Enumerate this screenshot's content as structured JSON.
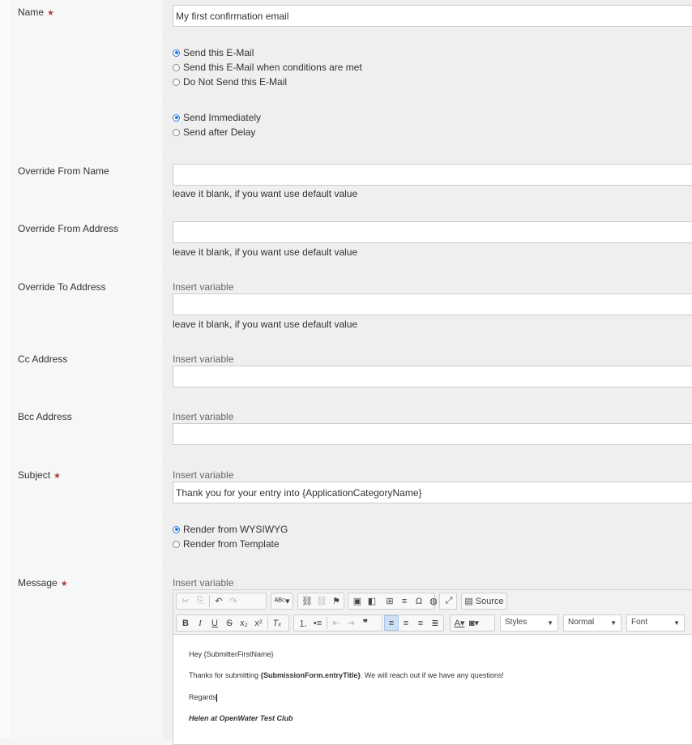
{
  "fields": {
    "name": {
      "label": "Name",
      "value": "My first confirmation email"
    },
    "send_mode": {
      "options": [
        "Send this E-Mail",
        "Send this E-Mail when conditions are met",
        "Do Not Send this E-Mail"
      ],
      "selected": "Send this E-Mail"
    },
    "timing": {
      "options": [
        "Send Immediately",
        "Send after Delay"
      ],
      "selected": "Send Immediately"
    },
    "from_name": {
      "label": "Override From Name",
      "value": "",
      "help": "leave it blank, if you want use default value"
    },
    "from_address": {
      "label": "Override From Address",
      "value": "",
      "help": "leave it blank, if you want use default value"
    },
    "to_address": {
      "label": "Override To Address",
      "insert_variable": "Insert variable",
      "value": "",
      "help": "leave it blank, if you want use default value"
    },
    "cc": {
      "label": "Cc Address",
      "insert_variable": "Insert variable",
      "value": ""
    },
    "bcc": {
      "label": "Bcc Address",
      "insert_variable": "Insert variable",
      "value": ""
    },
    "subject": {
      "label": "Subject",
      "insert_variable": "Insert variable",
      "value": "Thank you for your entry into {ApplicationCategoryName}"
    },
    "render": {
      "options": [
        "Render from WYSIWYG",
        "Render from Template"
      ],
      "selected": "Render from WYSIWYG"
    },
    "message": {
      "label": "Message",
      "insert_variable": "Insert variable"
    }
  },
  "required_marker": "★",
  "editor": {
    "source_label": "Source",
    "styles_label": "Styles",
    "format_label": "Normal",
    "font_label": "Font",
    "content": {
      "line1": "Hey {SubmitterFirstName}",
      "line2_before": "Thanks for submitting ",
      "line2_bold": "{SubmissionForm.entryTitle}",
      "line2_after": ". We will reach out if we have any questions!",
      "line3": "Regards",
      "signature": "Helen at OpenWater Test Club"
    }
  }
}
